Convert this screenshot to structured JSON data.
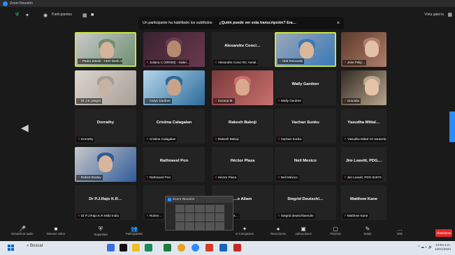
{
  "window": {
    "title": "Zoom Reunión"
  },
  "topbar": {
    "participants_label": "Participantes",
    "view_label": "Vista galería"
  },
  "banner": {
    "notice": "Un participante ha habilitado los subtítulos",
    "question": "¿Quién puede ver esta transcripción? Era…"
  },
  "tiles": [
    {
      "name": "",
      "label": "Pedro Steele - CEO Deeb Sola…",
      "video": true
    },
    {
      "name": "",
      "label": "Juliana C (SR003) - Gabri…",
      "video": true
    },
    {
      "name": "Alexandre Conci…",
      "label": "Alexandre Conci RC Aerial…",
      "video": false
    },
    {
      "name": "",
      "label": "Olaf Rekowski",
      "video": true
    },
    {
      "name": "",
      "label": "Jose Felip…",
      "video": true
    },
    {
      "name": "",
      "label": "Dr J.K.Jangra",
      "video": true
    },
    {
      "name": "",
      "label": "Carys Gardner",
      "video": true
    },
    {
      "name": "",
      "label": "Zuzana M.",
      "video": true
    },
    {
      "name": "Wally Gardner",
      "label": "Wally Gardner",
      "video": false
    },
    {
      "name": "",
      "label": "Graciela",
      "video": true
    },
    {
      "name": "Dorrathy",
      "label": "Dorrathy",
      "video": false
    },
    {
      "name": "Cristina Calagalan",
      "label": "Cristina Calagalan",
      "video": false
    },
    {
      "name": "Rakesh Baboji",
      "label": "Rakesh Baboji",
      "video": false
    },
    {
      "name": "Vachan Sunku",
      "label": "Vachan Sunku",
      "video": false
    },
    {
      "name": "Yasudha Mittal…",
      "label": "Yasudha Mittal Vd Jaravela",
      "video": false
    },
    {
      "name": "",
      "label": "Robert Bosley",
      "video": true
    },
    {
      "name": "Rathnavel Pon",
      "label": "Rathnavel Pon",
      "video": false
    },
    {
      "name": "Héctor Plaza",
      "label": "Héctor Plaza",
      "video": false
    },
    {
      "name": "Neli Mexico",
      "label": "Neli México",
      "video": false
    },
    {
      "name": "Jim Leavitt, PDG…",
      "label": "Jim Leavitt, PDG 81970",
      "video": false
    },
    {
      "name": "Dr P.J.Rajo K.R…",
      "label": "Dr P.J.Rajo K.R.Mitbi India",
      "video": false
    },
    {
      "name": "",
      "label": "Ruhee…",
      "video": false
    },
    {
      "name": "…o Allam",
      "label": "Juan Carlos…",
      "video": false
    },
    {
      "name": "Siegrid Deutschl…",
      "label": "Siegrid deutschlaender",
      "video": false
    },
    {
      "name": "Matthew Kane",
      "label": "Matthew Kane",
      "video": false
    }
  ],
  "preview": {
    "title": "Zoom Reunión"
  },
  "toolbar": {
    "items": [
      {
        "icon": "🎤",
        "label": "Desactivar audio"
      },
      {
        "icon": "■",
        "label": "Detener video"
      },
      {
        "icon": "⛨",
        "label": "Seguridad"
      },
      {
        "icon": "👥",
        "label": "Participantes"
      },
      {
        "icon": "✦",
        "label": "IA Companion"
      },
      {
        "icon": "●",
        "label": "Reacciones"
      },
      {
        "icon": "▣",
        "label": "Aplicaciones"
      },
      {
        "icon": "▢",
        "label": "Pizarras"
      },
      {
        "icon": "✎",
        "label": "Notas"
      },
      {
        "icon": "…",
        "label": "Más"
      }
    ],
    "leave_label": "Abandonar"
  },
  "taskbar": {
    "search_placeholder": "Buscar",
    "time": "10:54 a.m.",
    "date": "13/01/2024"
  }
}
